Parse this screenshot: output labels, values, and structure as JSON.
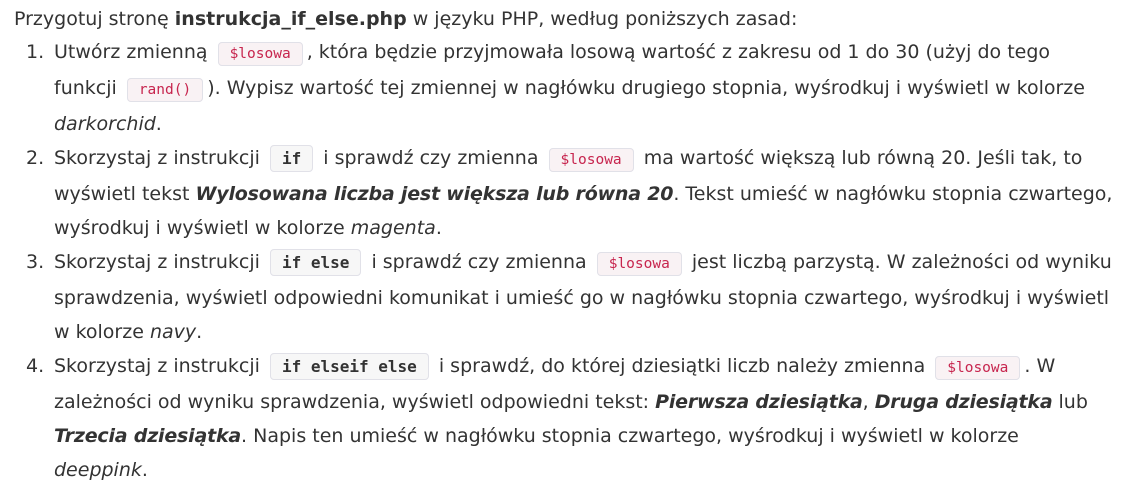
{
  "intro": {
    "before": "Przygotuj stronę ",
    "filename": "instrukcja_if_else.php",
    "after": " w języku PHP, według poniższych zasad:"
  },
  "tasks": [
    {
      "num": "1.",
      "t1": "Utwórz zmienną",
      "c1": "$losowa",
      "t2": ", która będzie przyjmowała losową wartość z zakresu od 1 do 30 (użyj do tego funkcji",
      "c2": "rand()",
      "t3": "). Wypisz wartość tej zmiennej w nagłówku drugiego stopnia, wyśrodkuj i wyświetl w kolorze ",
      "e1": "darkorchid",
      "t4": "."
    },
    {
      "num": "2.",
      "t1": "Skorzystaj z instrukcji",
      "c1": "if",
      "t2": "i sprawdź czy zmienna",
      "c2": "$losowa",
      "t3": "ma wartość większą lub równą 20. Jeśli tak, to wyświetl tekst ",
      "o1": "Wylosowana liczba jest większa lub równa 20",
      "t4": ". Tekst umieść w nagłówku stopnia czwartego, wyśrodkuj i wyświetl w kolorze ",
      "e1": "magenta",
      "t5": "."
    },
    {
      "num": "3.",
      "t1": "Skorzystaj z instrukcji",
      "c1": "if else",
      "t2": "i sprawdź czy zmienna",
      "c2": "$losowa",
      "t3": "jest liczbą parzystą. W zależności od wyniku sprawdzenia, wyświetl odpowiedni komunikat i umieść go w nagłówku stopnia czwartego, wyśrodkuj i wyświetl w kolorze ",
      "e1": "navy",
      "t4": "."
    },
    {
      "num": "4.",
      "t1": "Skorzystaj z instrukcji",
      "c1": "if elseif else",
      "t2": "i sprawdź, do której dziesiątki liczb należy zmienna",
      "c2": "$losowa",
      "t3": ". W zależności od wyniku sprawdzenia, wyświetl odpowiedni tekst: ",
      "o1": "Pierwsza dziesiątka",
      "t4": ", ",
      "o2": "Druga dziesiątka",
      "t5": " lub ",
      "o3": "Trzecia dziesiątka",
      "t6": ". Napis ten umieść w nagłówku stopnia czwartego, wyśrodkuj i wyświetl w kolorze ",
      "e1": "deeppink",
      "t7": "."
    }
  ]
}
